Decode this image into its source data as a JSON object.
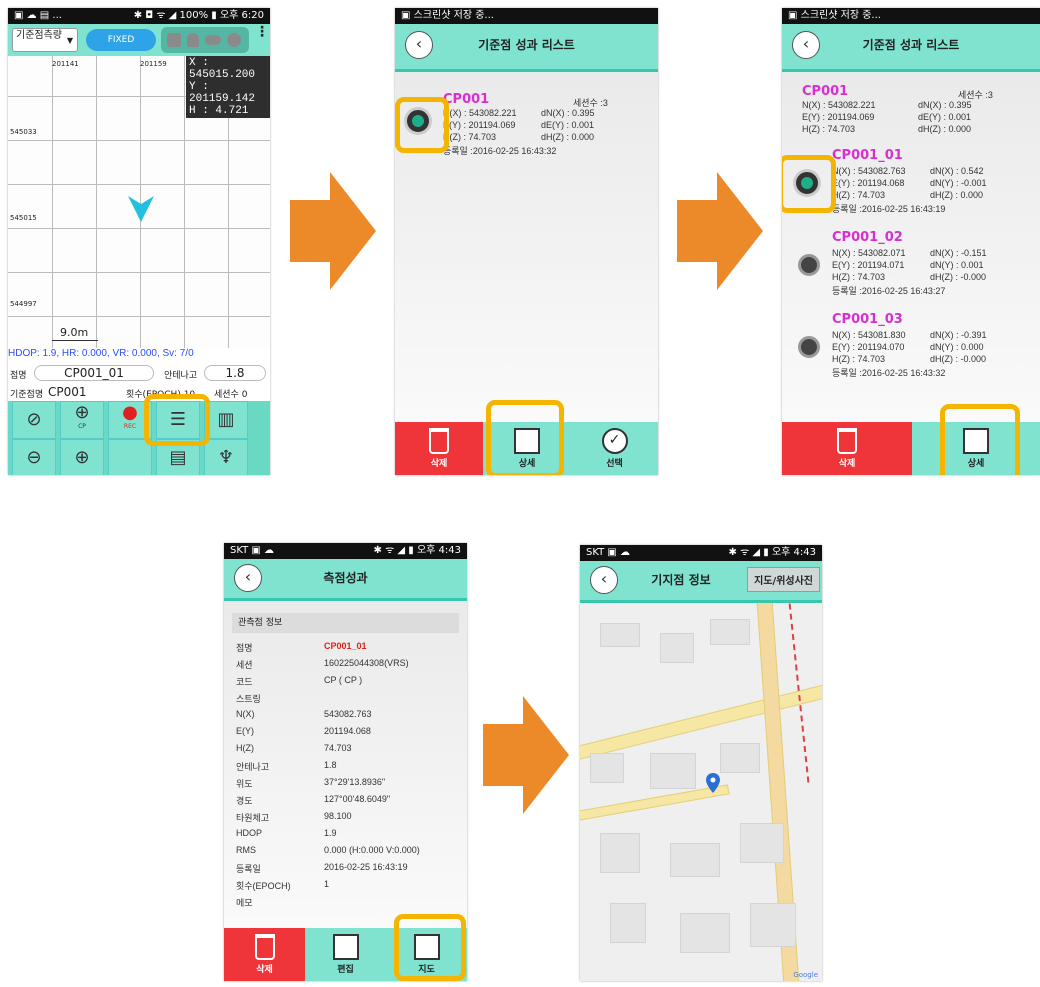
{
  "screen1": {
    "status_left": "▣ ☁ ▤ ...",
    "status_right": "✱ ◘ ᯤ ◢ 100% ▮ 오후 6:20",
    "dropdown_label": "기준점측량",
    "fixed_label": "FIXED",
    "coord_x": "X : 545015.200",
    "coord_y": "Y : 201159.142",
    "coord_h": "H : 4.721",
    "grid_top_1": "201141",
    "grid_top_2": "201159",
    "grid_left_1": "545033",
    "grid_left_2": "545015",
    "grid_left_3": "544997",
    "scale": "9.0m",
    "hdop": "HDOP: 1.9, HR: 0.000, VR: 0.000, Sv: 7/0",
    "point_label": "점명",
    "point_value": "CP001_01",
    "antenna_label": "안테나고",
    "antenna_value": "1.8",
    "base_label": "기준점명",
    "base_value": "CP001",
    "epoch_text": "횟수(EPOCH) 10",
    "session_text": "세션수 0",
    "cp_label": "CP",
    "rec_label": "REC"
  },
  "screen2": {
    "status_text": "스크린샷 저장 중...",
    "title": "기준점 성과 리스트",
    "cp_name": "CP001",
    "session": "세션수 :3",
    "n": "N(X) : 543082.221",
    "dn": "dN(X) : 0.395",
    "e": "E(Y) : 201194.069",
    "de": "dE(Y) : 0.001",
    "h": "H(Z) : 74.703",
    "dh": "dH(Z) : 0.000",
    "date": "등록일 :2016-02-25 16:43:32",
    "btn_delete": "삭제",
    "btn_detail": "상세",
    "btn_select": "선택"
  },
  "screen3": {
    "status_text": "스크린샷 저장 중...",
    "title": "기준점 성과 리스트",
    "base": {
      "name": "CP001",
      "session": "세션수 :3",
      "n": "N(X) : 543082.221",
      "dn": "dN(X) : 0.395",
      "e": "E(Y) : 201194.069",
      "de": "dE(Y) : 0.001",
      "h": "H(Z) : 74.703",
      "dh": "dH(Z) : 0.000"
    },
    "items": [
      {
        "name": "CP001_01",
        "n": "N(X) : 543082.763",
        "dn": "dN(X) : 0.542",
        "e": "E(Y) : 201194.068",
        "de": "dN(Y) : -0.001",
        "h": "H(Z) : 74.703",
        "dh": "dH(Z) : 0.000",
        "date": "등록일 :2016-02-25 16:43:19"
      },
      {
        "name": "CP001_02",
        "n": "N(X) : 543082.071",
        "dn": "dN(X) : -0.151",
        "e": "E(Y) : 201194.071",
        "de": "dN(Y) : 0.001",
        "h": "H(Z) : 74.703",
        "dh": "dH(Z) : -0.000",
        "date": "등록일 :2016-02-25 16:43:27"
      },
      {
        "name": "CP001_03",
        "n": "N(X) : 543081.830",
        "dn": "dN(X) : -0.391",
        "e": "E(Y) : 201194.070",
        "de": "dN(Y) : 0.000",
        "h": "H(Z) : 74.703",
        "dh": "dH(Z) : -0.000",
        "date": "등록일 :2016-02-25 16:43:32"
      }
    ],
    "btn_delete": "삭제",
    "btn_detail": "상세"
  },
  "screen4": {
    "status_left": "SKT ▣ ☁",
    "status_right": "✱ ᯤ ◢ ▮ 오후 4:43",
    "title": "측점성과",
    "section": "관측점 정보",
    "rows": [
      {
        "k": "점명",
        "v": "CP001_01"
      },
      {
        "k": "세션",
        "v": "160225044308(VRS)"
      },
      {
        "k": "코드",
        "v": "CP ( CP )"
      },
      {
        "k": "스트링",
        "v": ""
      },
      {
        "k": "N(X)",
        "v": "543082.763"
      },
      {
        "k": "E(Y)",
        "v": "201194.068"
      },
      {
        "k": "H(Z)",
        "v": "74.703"
      },
      {
        "k": "안테나고",
        "v": "1.8"
      },
      {
        "k": "위도",
        "v": "37°29'13.8936\""
      },
      {
        "k": "경도",
        "v": "127°00'48.6049\""
      },
      {
        "k": "타원체고",
        "v": "98.100"
      },
      {
        "k": "HDOP",
        "v": "1.9"
      },
      {
        "k": "RMS",
        "v": "0.000 (H:0.000 V:0.000)"
      },
      {
        "k": "등록일",
        "v": "2016-02-25 16:43:19"
      },
      {
        "k": "횟수(EPOCH)",
        "v": "1"
      },
      {
        "k": "메모",
        "v": ""
      }
    ],
    "btn_delete": "삭제",
    "btn_edit": "편집",
    "btn_map": "지도"
  },
  "screen5": {
    "status_left": "SKT ▣ ☁",
    "status_right": "✱ ᯤ ◢ ▮ 오후 4:43",
    "title": "기지점 정보",
    "map_btn": "지도/위성사진",
    "google": "Google"
  },
  "colors": {
    "teal": "#7fe3d0",
    "highlight": "#f5b400",
    "delete_red": "#f0353a",
    "magenta": "#d82fd0",
    "arrow": "#ec8a2a"
  }
}
